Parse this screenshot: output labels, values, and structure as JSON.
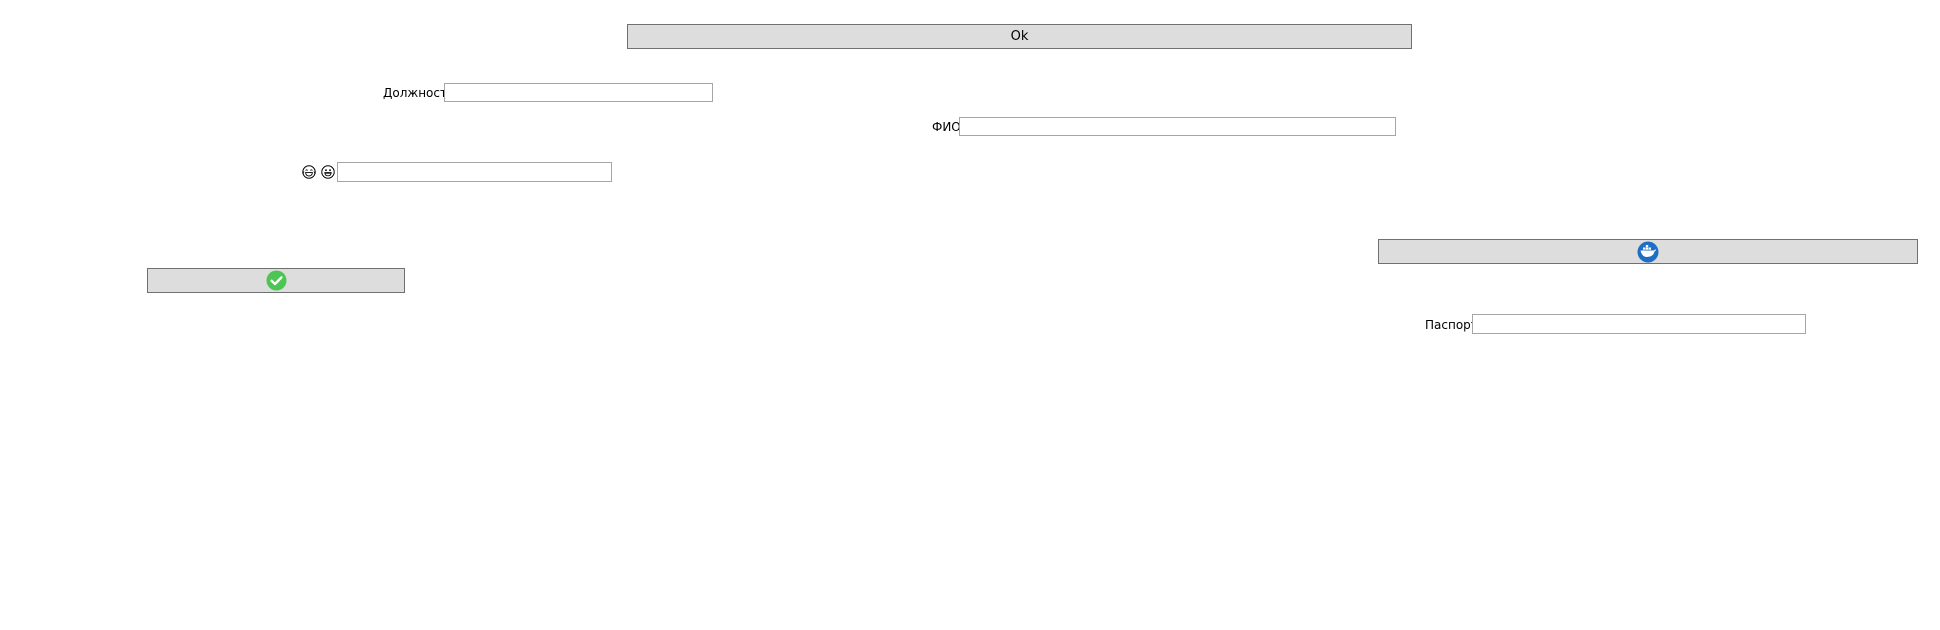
{
  "buttons": {
    "ok_label": "Ok",
    "check_icon": "check-circle-icon",
    "check_color": "#4cc552",
    "docker_icon": "docker-whale-icon",
    "docker_color": "#1e6fc4"
  },
  "fields": {
    "position": {
      "label": "Должность",
      "value": ""
    },
    "fio": {
      "label": "ФИО",
      "value": ""
    },
    "emoji": {
      "icons": [
        "laughing-face-icon",
        "grinning-face-icon"
      ],
      "value": ""
    },
    "passport": {
      "label": "Паспорт",
      "value": ""
    }
  }
}
